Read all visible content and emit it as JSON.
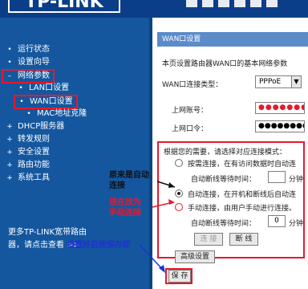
{
  "header": {
    "logo": "TP-LINK"
  },
  "sidebar": {
    "items": [
      {
        "label": "运行状态"
      },
      {
        "label": "设置向导"
      },
      {
        "label": "网络参数"
      },
      {
        "label": "LAN口设置"
      },
      {
        "label": "WAN口设置"
      },
      {
        "label": "MAC地址克隆"
      },
      {
        "label": "DHCP服务器"
      },
      {
        "label": "转发规则"
      },
      {
        "label": "安全设置"
      },
      {
        "label": "路由功能"
      },
      {
        "label": "系统工具"
      }
    ],
    "footer_line1": "更多TP-LINK宽带路由",
    "footer_line2": "器，请点击查看 >>"
  },
  "panel": {
    "title": "WAN口设置",
    "description": "本页设置路由器WAN口的基本网络参数",
    "wan_type_label": "WAN口连接类型：",
    "wan_type_value": "PPPoE",
    "account_label": "上网账号：",
    "account_value": "●●●●●●●●●",
    "password_label": "上网口令：",
    "password_value": "●●●●●●●●●"
  },
  "options": {
    "heading": "根据您的需要，请选择对应连接模式：",
    "demand": "按需连接，在有访问数据时自动连",
    "demand_wait_label": "自动断线等待时间：",
    "demand_wait_value": "",
    "demand_unit": "分钟",
    "auto": "自动连接，在开机和断线后自动连",
    "manual": "手动连接，由用户手动进行连接。",
    "manual_wait_label": "自动断线等待时间：",
    "manual_wait_value": "0",
    "manual_unit": "分钟"
  },
  "buttons": {
    "connect": "连 接",
    "disconnect": "断 线",
    "advanced": "高级设置",
    "save": "保 存"
  },
  "annotations": {
    "was_line1": "原来是自动",
    "was_line2": "连接",
    "now_line1": "现在改为",
    "now_line2": "手动连接",
    "save_hint": "设置好后按保存即"
  },
  "colors": {
    "header_bg": "#0a3e88",
    "sidebar_bg": "#14579f",
    "highlight_red": "#e8182c",
    "annotation_blue": "#1e32d2"
  }
}
